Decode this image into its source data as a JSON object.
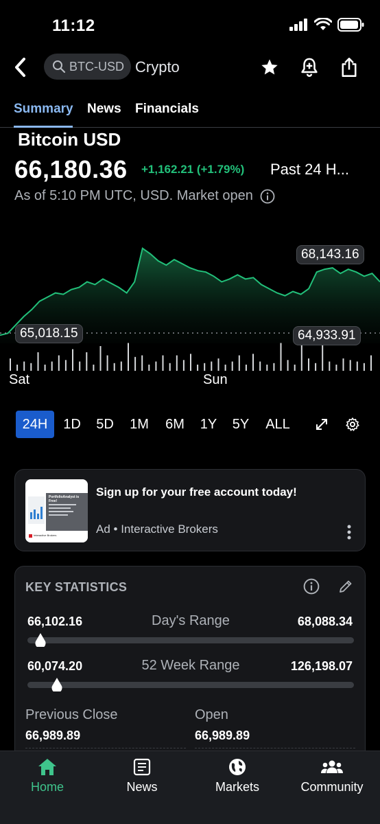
{
  "status": {
    "time": "11:12"
  },
  "nav": {
    "search_text": "BTC-USD",
    "crypto_label": "Crypto"
  },
  "tabs": [
    {
      "label": "Summary",
      "active": true
    },
    {
      "label": "News",
      "active": false
    },
    {
      "label": "Financials",
      "active": false
    }
  ],
  "quote": {
    "name": "Bitcoin USD",
    "price": "66,180.36",
    "change": "+1,162.21 (+1.79%)",
    "period": "Past 24 H...",
    "as_of": "As of 5:10 PM UTC, USD. Market open"
  },
  "chart_data": {
    "type": "area",
    "high_label": "68,143.16",
    "prev_close_label": "65,018.15",
    "low_label": "64,933.91",
    "x_labels": [
      "Sat",
      "Sun"
    ],
    "prices": [
      64980,
      65050,
      65350,
      65650,
      65900,
      66200,
      66350,
      66500,
      66450,
      66620,
      66700,
      66900,
      66800,
      67000,
      66850,
      66700,
      66500,
      66900,
      68100,
      67900,
      67650,
      67500,
      67700,
      67550,
      67400,
      67300,
      67250,
      67100,
      66900,
      67000,
      67150,
      67000,
      67050,
      66800,
      66650,
      66500,
      66400,
      66550,
      66450,
      66650,
      67250,
      67350,
      67400,
      67200,
      67350,
      67250,
      67100,
      67200,
      66900
    ],
    "volumes": [
      0.4,
      0.2,
      0.3,
      0.25,
      0.6,
      0.2,
      0.3,
      0.5,
      0.35,
      0.7,
      0.3,
      0.6,
      0.2,
      0.8,
      0.5,
      0.25,
      0.3,
      0.9,
      0.45,
      0.5,
      0.2,
      0.3,
      0.5,
      0.25,
      0.5,
      0.35,
      0.55,
      0.2,
      0.25,
      0.3,
      0.4,
      0.2,
      0.3,
      0.5,
      0.2,
      0.55,
      0.3,
      0.2,
      0.25,
      0.9,
      0.35,
      0.2,
      0.9,
      0.4,
      0.25,
      0.9,
      0.3,
      0.2,
      0.4,
      0.35,
      0.3,
      0.25,
      0.5
    ]
  },
  "ranges": [
    {
      "label": "24H",
      "active": true
    },
    {
      "label": "1D",
      "active": false
    },
    {
      "label": "5D",
      "active": false
    },
    {
      "label": "1M",
      "active": false
    },
    {
      "label": "6M",
      "active": false
    },
    {
      "label": "1Y",
      "active": false
    },
    {
      "label": "5Y",
      "active": false
    },
    {
      "label": "ALL",
      "active": false
    }
  ],
  "ad": {
    "title": "Sign up for your free account today!",
    "sponsor": "Ad • Interactive Brokers",
    "thumb_heading": "PortfolioAnalyst is Free!",
    "thumb_brand": "Interactive Brokers"
  },
  "stats": {
    "title": "KEY STATISTICS",
    "day_range": {
      "label": "Day's Range",
      "low": "66,102.16",
      "high": "68,088.34",
      "position": 0.04
    },
    "week_range": {
      "label": "52 Week Range",
      "low": "60,074.20",
      "high": "126,198.07",
      "position": 0.09
    },
    "prev_close": {
      "label": "Previous Close",
      "value": "66,989.89"
    },
    "open": {
      "label": "Open",
      "value": "66,989.89"
    }
  },
  "bottom_nav": [
    {
      "label": "Home",
      "active": true
    },
    {
      "label": "News",
      "active": false
    },
    {
      "label": "Markets",
      "active": false
    },
    {
      "label": "Community",
      "active": false
    }
  ],
  "colors": {
    "accent": "#22c07a",
    "link": "#8ab8f0",
    "active_range": "#1a5ccc"
  }
}
